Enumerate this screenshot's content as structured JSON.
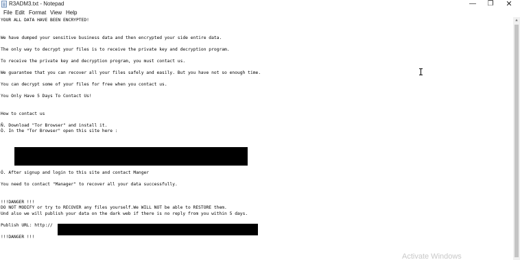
{
  "window": {
    "title": "R3ADM3.txt - Notepad",
    "minimize_glyph": "—",
    "maximize_glyph": "❐",
    "close_glyph": "✕"
  },
  "menu": {
    "file": "File",
    "edit": "Edit",
    "format": "Format",
    "view": "View",
    "help": "Help"
  },
  "note": {
    "l01": "YOUR ALL DATA HAVE BEEN ENCRYPTED!",
    "l02": "We have dumped your sensitive business data and then encrypted your side entire data.",
    "l03": "The only way to decrypt your files is to receive the private key and decryption program.",
    "l04": "To receive the private key and decryption program, you must contact us.",
    "l05": "We guarantee that you can recover all your files safely and easily. But you have not so enough time.",
    "l06": "You can decrypt some of your files for free when you contact us.",
    "l07": "You Only Have 5 Days To Contact Us!",
    "l08": "How to contact us",
    "l09": "Ñ. Download \"Tor Browser\" and install it.",
    "l10": "Ò. In the \"Tor Browser\" open this site here :",
    "l11": "Ó. After signup and login to this site and contact Manger",
    "l12": "You need to contact \"Manager\" to recover all your data successfully.",
    "l13": "!!!DANGER !!!",
    "l14": "DO NOT MODIFY or try to RECOVER any files yourself.We WILL NOT be able to RESTORE them.",
    "l15": "Und also we will publish your data on the dark web if there is no reply from you within 5 days.",
    "l16": "Publish URL: http://",
    "l17": "!!!DANGER !!!"
  },
  "watermark": "Activate Windows",
  "icons": {
    "app": "notepad-icon",
    "cursor": "text-cursor-icon"
  }
}
